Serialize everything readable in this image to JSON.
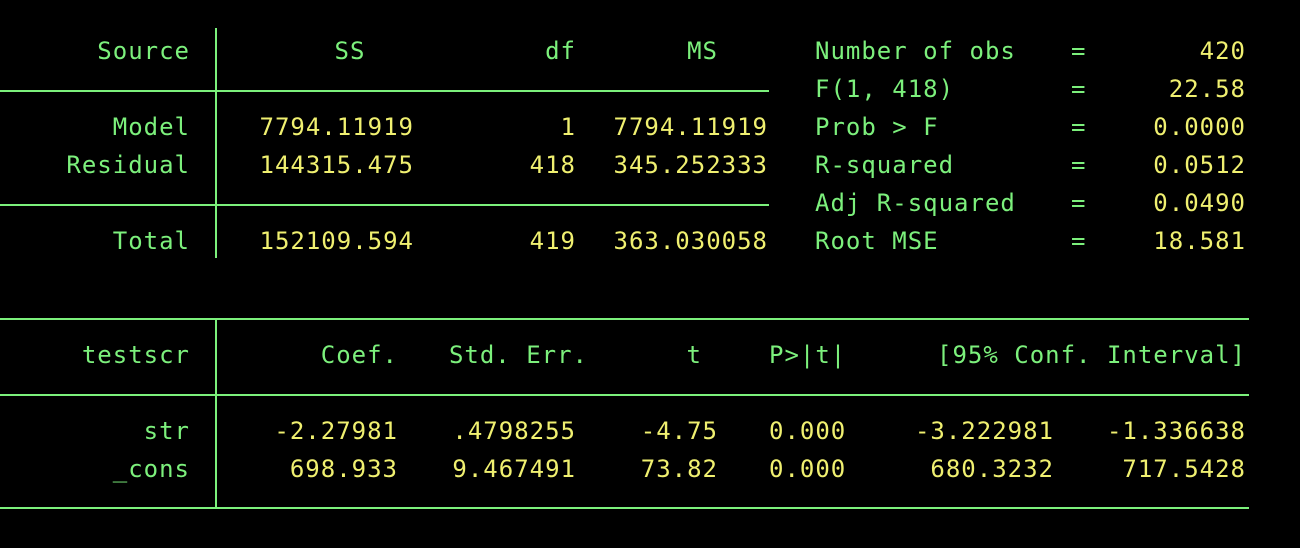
{
  "anova": {
    "headers": {
      "source": "Source",
      "ss": "SS",
      "df": "df",
      "ms": "MS"
    },
    "rows": [
      {
        "source": "Model",
        "ss": "7794.11919",
        "df": "1",
        "ms": "7794.11919"
      },
      {
        "source": "Residual",
        "ss": "144315.475",
        "df": "418",
        "ms": "345.252333"
      },
      {
        "source": "Total",
        "ss": "152109.594",
        "df": "419",
        "ms": "363.030058"
      }
    ]
  },
  "stats": [
    {
      "label": "Number of obs",
      "eq": "=",
      "value": "420"
    },
    {
      "label": "F(1, 418)",
      "eq": "=",
      "value": "22.58"
    },
    {
      "label": "Prob > F",
      "eq": "=",
      "value": "0.0000"
    },
    {
      "label": "R-squared",
      "eq": "=",
      "value": "0.0512"
    },
    {
      "label": "Adj R-squared",
      "eq": "=",
      "value": "0.0490"
    },
    {
      "label": "Root MSE",
      "eq": "=",
      "value": "18.581"
    }
  ],
  "coef_table": {
    "headers": {
      "depvar": "testscr",
      "coef": "Coef.",
      "se": "Std. Err.",
      "t": "t",
      "p": "P>|t|",
      "ci": "[95% Conf. Interval]"
    },
    "rows": [
      {
        "var": "str",
        "coef": "-2.27981",
        "se": ".4798255",
        "t": "-4.75",
        "p": "0.000",
        "lo": "-3.222981",
        "hi": "-1.336638"
      },
      {
        "var": "_cons",
        "coef": "698.933",
        "se": "9.467491",
        "t": "73.82",
        "p": "0.000",
        "lo": "680.3232",
        "hi": "717.5428"
      }
    ]
  },
  "colors": {
    "background": "#000000",
    "label_green": "#7cf07c",
    "value_yellow": "#f0f070"
  }
}
